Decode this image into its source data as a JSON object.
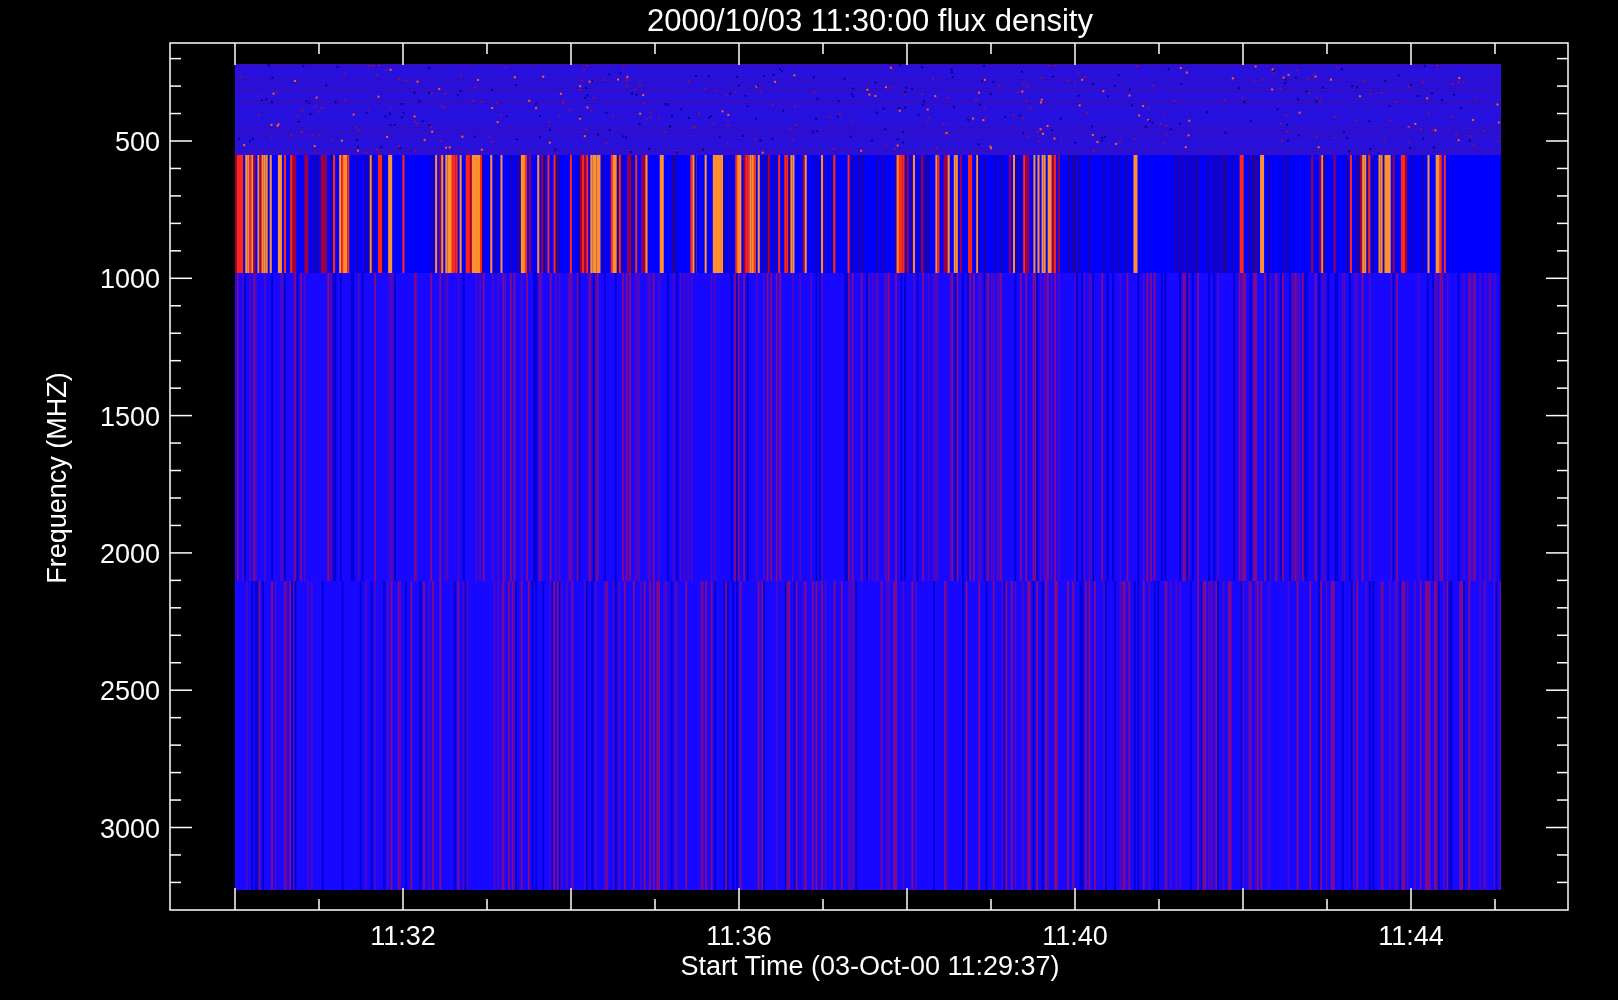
{
  "figure": {
    "title": "2000/10/03 11:30:00 flux density",
    "ylabel": "Frequency (MHZ)",
    "xlabel": "Start Time (03-Oct-00 11:29:37)",
    "yticks": [
      "500",
      "1000",
      "1500",
      "2000",
      "2500",
      "3000"
    ],
    "xticks": [
      "11:32",
      "11:36",
      "11:40",
      "11:44"
    ]
  }
}
